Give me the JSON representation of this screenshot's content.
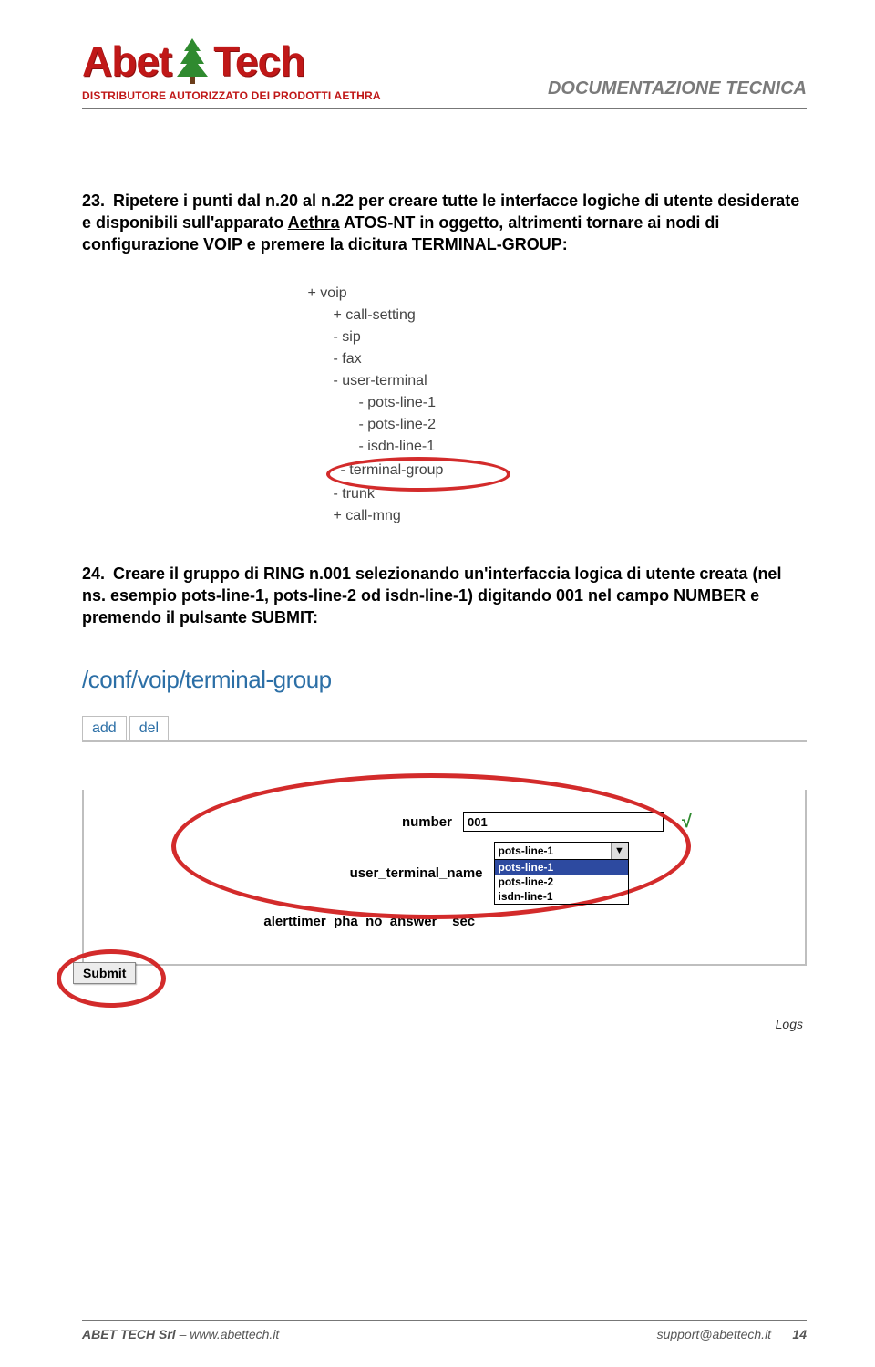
{
  "header": {
    "logo_abet": "Abet",
    "logo_tech": "Tech",
    "distributor_line": "DISTRIBUTORE AUTORIZZATO DEI PRODOTTI AETHRA",
    "doc_title": "DOCUMENTAZIONE  TECNICA"
  },
  "para23_num": "23.",
  "para23_t1": "Ripetere i punti dal n.20 al n.22 per creare tutte le interfacce logiche di utente desiderate e disponibili sull'apparato ",
  "para23_link": "Aethra",
  "para23_t2": " ATOS-NT in oggetto, altrimenti tornare ai nodi di configurazione VOIP e premere la dicitura TERMINAL-GROUP:",
  "tree": {
    "voip": "+ voip",
    "call_setting": "+ call-setting",
    "sip": "- sip",
    "fax": "- fax",
    "user_terminal": "- user-terminal",
    "pots1": "- pots-line-1",
    "pots2": "- pots-line-2",
    "isdn1": "- isdn-line-1",
    "term_group": "- terminal-group",
    "trunk": "- trunk",
    "call_mng": "+ call-mng"
  },
  "para24_num": "24.",
  "para24_text": "Creare il gruppo di RING n.001 selezionando un'interfaccia logica di utente creata (nel ns. esempio pots-line-1, pots-line-2 od isdn-line-1) digitando 001 nel campo NUMBER e premendo il pulsante SUBMIT:",
  "config": {
    "breadcrumb": "/conf/voip/terminal-group",
    "tabs": {
      "add": "add",
      "del": "del"
    },
    "labels": {
      "number": "number",
      "user_terminal_name": "user_terminal_name",
      "alerttimer": "alerttimer_pha_no_answer__sec_"
    },
    "values": {
      "number": "001",
      "selected_terminal": "pots-line-1"
    },
    "select_options": [
      "pots-line-1",
      "pots-line-2",
      "isdn-line-1"
    ],
    "submit_label": "Submit",
    "logs_link": "Logs"
  },
  "footer": {
    "company": "ABET TECH Srl",
    "sep": "   –   ",
    "url": "www.abettech.it",
    "support": "support@abettech.it",
    "page": "14"
  }
}
